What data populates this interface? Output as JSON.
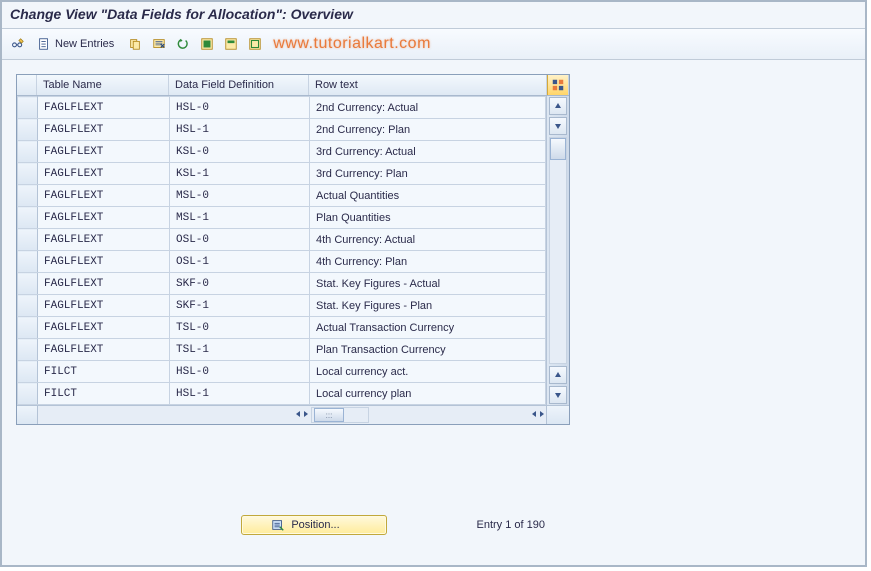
{
  "title": "Change View \"Data Fields for Allocation\": Overview",
  "toolbar": {
    "new_entries": "New Entries"
  },
  "watermark": "www.tutorialkart.com",
  "columns": {
    "table_name": "Table Name",
    "data_field_def": "Data Field Definition",
    "row_text": "Row text"
  },
  "rows": [
    {
      "table": "FAGLFLEXT",
      "def": "HSL-0",
      "text": "2nd Currency: Actual"
    },
    {
      "table": "FAGLFLEXT",
      "def": "HSL-1",
      "text": "2nd Currency: Plan"
    },
    {
      "table": "FAGLFLEXT",
      "def": "KSL-0",
      "text": "3rd Currency: Actual"
    },
    {
      "table": "FAGLFLEXT",
      "def": "KSL-1",
      "text": "3rd Currency: Plan"
    },
    {
      "table": "FAGLFLEXT",
      "def": "MSL-0",
      "text": "Actual Quantities"
    },
    {
      "table": "FAGLFLEXT",
      "def": "MSL-1",
      "text": "Plan Quantities"
    },
    {
      "table": "FAGLFLEXT",
      "def": "OSL-0",
      "text": "4th Currency: Actual"
    },
    {
      "table": "FAGLFLEXT",
      "def": "OSL-1",
      "text": "4th Currency: Plan"
    },
    {
      "table": "FAGLFLEXT",
      "def": "SKF-0",
      "text": "Stat. Key Figures - Actual"
    },
    {
      "table": "FAGLFLEXT",
      "def": "SKF-1",
      "text": "Stat. Key Figures - Plan"
    },
    {
      "table": "FAGLFLEXT",
      "def": "TSL-0",
      "text": "Actual Transaction Currency"
    },
    {
      "table": "FAGLFLEXT",
      "def": "TSL-1",
      "text": "Plan Transaction Currency"
    },
    {
      "table": "FILCT",
      "def": "HSL-0",
      "text": "Local currency act."
    },
    {
      "table": "FILCT",
      "def": "HSL-1",
      "text": "Local currency plan"
    }
  ],
  "footer": {
    "position": "Position...",
    "entry": "Entry 1 of 190"
  }
}
